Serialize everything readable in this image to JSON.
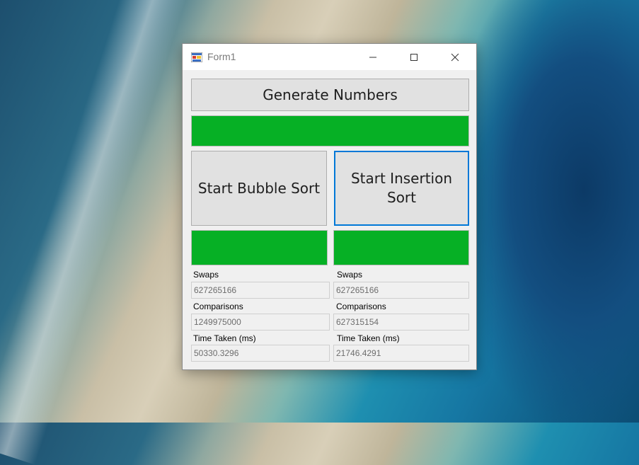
{
  "window": {
    "title": "Form1",
    "icon": "form-app-icon"
  },
  "controls": {
    "minimize_icon": "minimize-icon",
    "maximize_icon": "maximize-icon",
    "close_icon": "close-icon"
  },
  "generate_button": {
    "label": "Generate Numbers"
  },
  "generate_progress": {
    "value": 1.0
  },
  "bubble": {
    "button_label": "Start Bubble Sort",
    "progress": 1.0,
    "swaps_label": "Swaps",
    "swaps_value": "627265166",
    "comparisons_label": "Comparisons",
    "comparisons_value": "1249975000",
    "time_label": "Time Taken (ms)",
    "time_value": "50330.3296"
  },
  "insertion": {
    "button_label": "Start Insertion Sort",
    "progress": 1.0,
    "swaps_label": "Swaps",
    "swaps_value": "627265166",
    "comparisons_label": "Comparisons",
    "comparisons_value": "627315154",
    "time_label": "Time Taken (ms)",
    "time_value": "21746.4291"
  },
  "colors": {
    "progress": "#06b025",
    "focus": "#0078d7"
  }
}
